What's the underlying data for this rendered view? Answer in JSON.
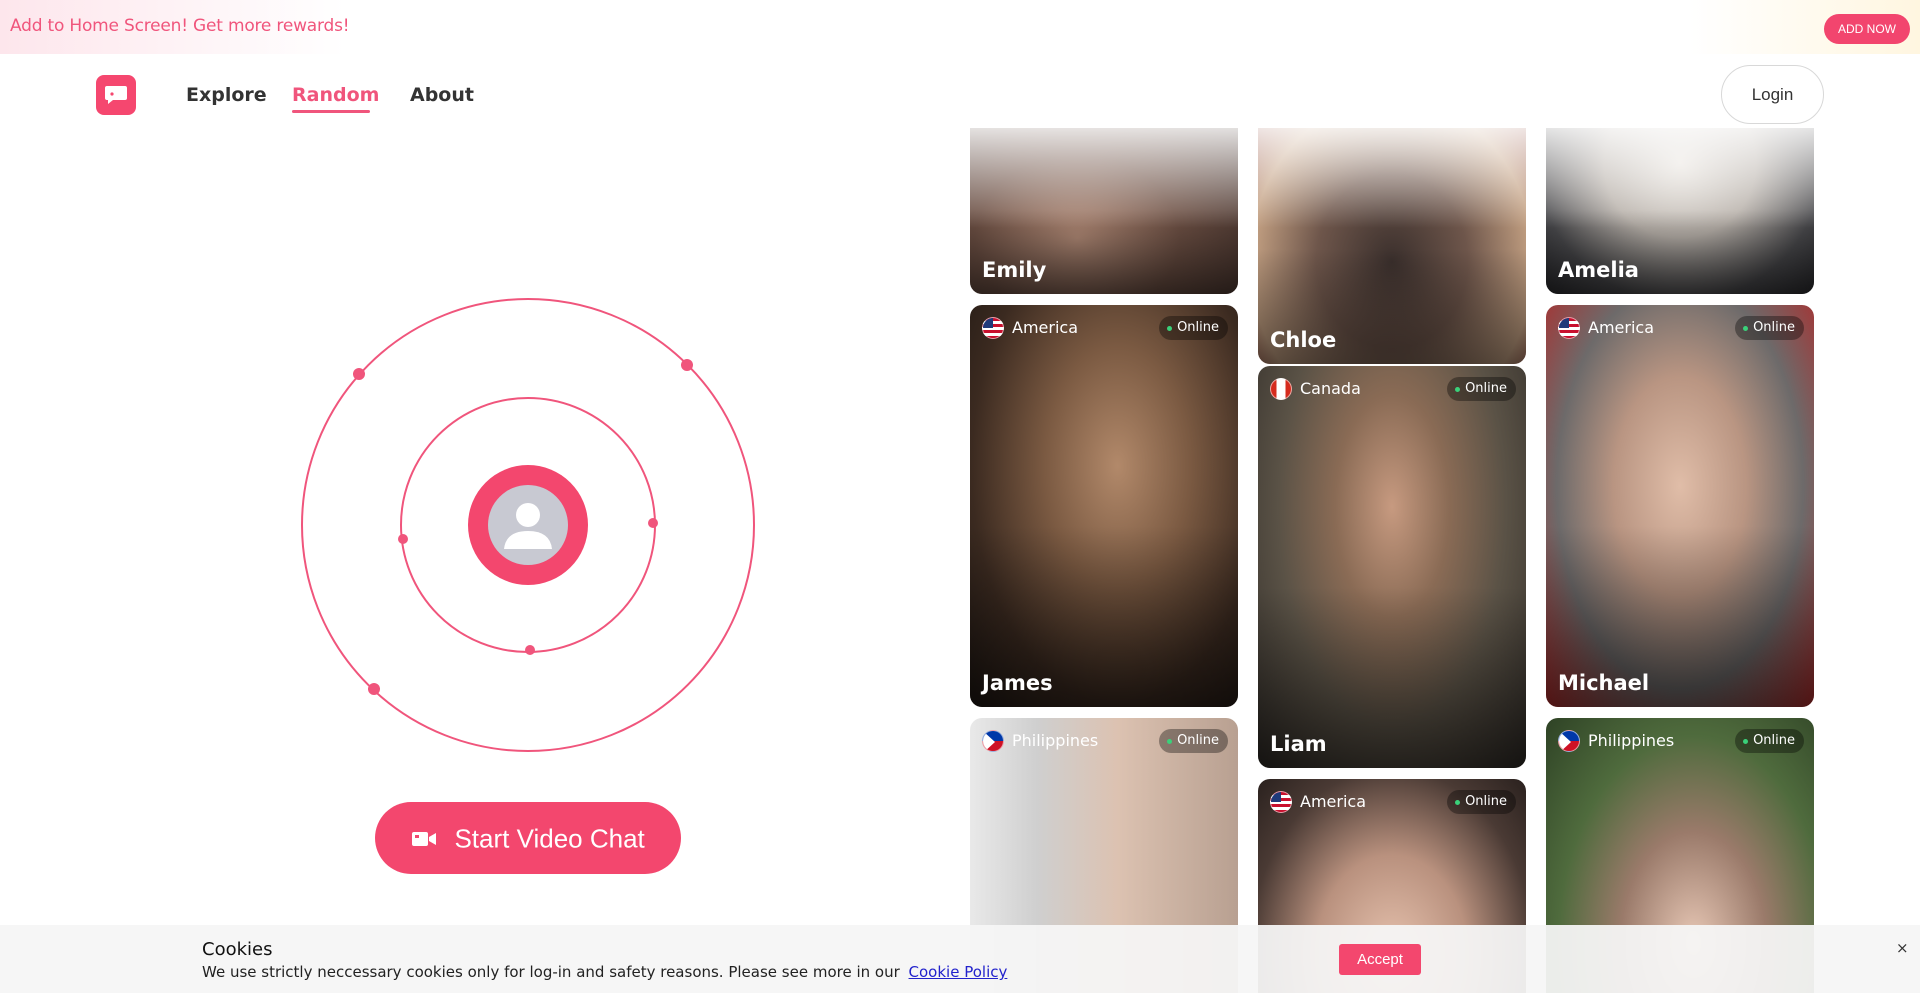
{
  "promo": {
    "text": "Add to Home Screen! Get more rewards!",
    "button": "ADD NOW"
  },
  "header": {
    "logo_icon": "chat-bubble-icon",
    "nav": [
      {
        "label": "Explore",
        "active": false
      },
      {
        "label": "Random",
        "active": true
      },
      {
        "label": "About",
        "active": false
      }
    ],
    "login": "Login"
  },
  "hero": {
    "start_button": "Start Video Chat",
    "start_icon": "video-camera-icon",
    "avatar_icon": "person-icon"
  },
  "cards": [
    {
      "name": "Emily",
      "country": "",
      "status": ""
    },
    {
      "name": "Chloe",
      "country": "",
      "status": ""
    },
    {
      "name": "Amelia",
      "country": "",
      "status": ""
    },
    {
      "name": "James",
      "country": "America",
      "status": "Online",
      "flag": "us-flag-icon"
    },
    {
      "name": "Liam",
      "country": "Canada",
      "status": "Online",
      "flag": "canada-flag-icon"
    },
    {
      "name": "Michael",
      "country": "America",
      "status": "Online",
      "flag": "us-flag-icon"
    },
    {
      "name": "",
      "country": "Philippines",
      "status": "Online",
      "flag": "philippines-flag-icon"
    },
    {
      "name": "",
      "country": "America",
      "status": "Online",
      "flag": "us-flag-icon"
    },
    {
      "name": "",
      "country": "Philippines",
      "status": "Online",
      "flag": "philippines-flag-icon"
    }
  ],
  "cookie": {
    "title": "Cookies",
    "text": "We use strictly neccessary cookies only for log-in and safety reasons. Please see more in our",
    "link": "Cookie Policy",
    "accept": "Accept",
    "close": "×"
  },
  "colors": {
    "accent": "#f3476e",
    "online": "#3ad17a"
  }
}
